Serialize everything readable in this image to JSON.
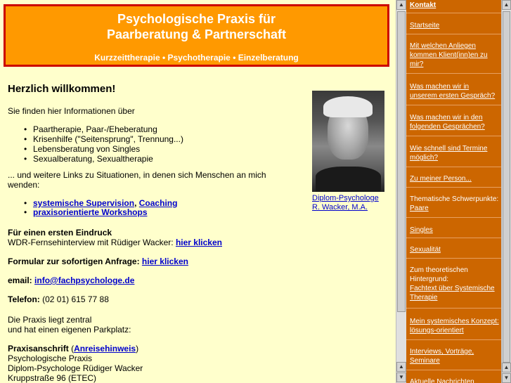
{
  "header": {
    "title_line1": "Psychologische Praxis für",
    "title_line2": "Paarberatung & Partnerschaft",
    "subtitle": "Kurzzeittherapie • Psychotherapie • Einzelberatung"
  },
  "main": {
    "welcome": "Herzlich willkommen!",
    "intro": "Sie finden hier Informationen über",
    "topics": [
      "Paartherapie, Paar-/Eheberatung",
      "Krisenhilfe (\"Seitensprung\", Trennung...)",
      "Lebensberatung von Singles",
      "Sexualberatung, Sexualtherapie"
    ],
    "links_intro_1": "... und weitere Links zu Situationen, in denen sich Menschen an mich",
    "links_intro_2": "wenden:",
    "supervision": "systemische Supervision",
    "comma": ",",
    "coaching": "Coaching",
    "workshops": "praxisorientierte Workshops",
    "first_impression": "Für einen ersten Eindruck",
    "wdr_text": "WDR-Fernsehinterview mit Rüdiger Wacker:",
    "wdr_link": "hier klicken",
    "form_text": "Formular zur sofortigen Anfrage:",
    "form_link": "hier klicken",
    "email_label": "email:",
    "email_link": "info@fachpsychologe.de",
    "phone_label": "Telefon:",
    "phone_value": "(02 01) 615 77 88",
    "location_1": "Die Praxis liegt zentral",
    "location_2": "und hat einen eigenen Parkplatz:",
    "address_label": "Praxisanschrift",
    "address_paren_open": "(",
    "directions_link": "Anreisehinweis",
    "address_paren_close": ")",
    "address_1": "Psychologische Praxis",
    "address_2": "Diplom-Psychologe Rüdiger Wacker",
    "address_3": "Kruppstraße 96 (ETEC)",
    "photo_caption_1": "Diplom-Psychologe",
    "photo_caption_2": "R. Wacker, M.A."
  },
  "sidebar": {
    "items": [
      {
        "text": "Kontakt",
        "type": "heading"
      },
      {
        "text": "Startseite",
        "type": "link"
      },
      {
        "text": "Mit welchen Anliegen kommen Klient(inn)en zu mir?",
        "type": "link"
      },
      {
        "text": "Was machen wir in unserem ersten Gespräch?",
        "type": "link"
      },
      {
        "text": "Was machen wir in den folgenden Gesprächen?",
        "type": "link"
      },
      {
        "text": "Wie schnell sind Termine möglich?",
        "type": "link"
      },
      {
        "text": "Zu meiner Person...",
        "type": "link"
      },
      {
        "text": "Thematische Schwerpunkte:",
        "type": "text",
        "link": "Paare"
      },
      {
        "text": "Singles",
        "type": "link"
      },
      {
        "text": "Sexualität",
        "type": "link"
      },
      {
        "text": "Zum theoretischen Hintergrund:",
        "type": "text",
        "link": "Fachtext über Systemische Therapie"
      },
      {
        "text": "Mein systemisches Konzept:",
        "type": "text",
        "link": "lösungs-orientiert"
      },
      {
        "text": "Interviews, Vorträge, Seminare",
        "type": "link"
      },
      {
        "text": "Aktuelle Nachrichten",
        "type": "link"
      }
    ]
  },
  "colors": {
    "header_bg": "#ff9900",
    "header_border": "#cc0000",
    "page_bg": "#ffffcc",
    "sidebar_bg": "#cc6600",
    "link": "#0000cc"
  }
}
